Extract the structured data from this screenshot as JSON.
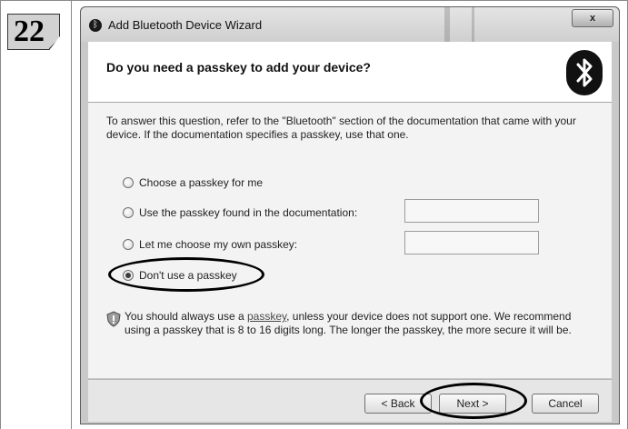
{
  "step_number": "22",
  "window": {
    "title": "Add Bluetooth Device Wizard",
    "close_label": "x"
  },
  "header": {
    "title": "Do you need a passkey to add your device?"
  },
  "intro_text": "To answer this question, refer to the \"Bluetooth\" section of the documentation that came with your device. If the documentation specifies a passkey, use that one.",
  "options": [
    {
      "label": "Choose a passkey for me",
      "selected": false
    },
    {
      "label": "Use the passkey found in the documentation:",
      "selected": false
    },
    {
      "label": "Let me choose my own passkey:",
      "selected": false
    },
    {
      "label": "Don't use a passkey",
      "selected": true
    }
  ],
  "inputs": {
    "documentation_passkey": "",
    "own_passkey": ""
  },
  "note": {
    "before_link": "You should always use a ",
    "link": "passkey",
    "after_link": ", unless your device does not support one. We recommend using a passkey that is 8 to 16 digits long. The longer the passkey, the more secure it will be."
  },
  "buttons": {
    "back": "< Back",
    "next": "Next >",
    "cancel": "Cancel"
  },
  "icons": {
    "title": "bluetooth-icon",
    "header": "bluetooth-logo-icon",
    "note": "shield-icon"
  }
}
